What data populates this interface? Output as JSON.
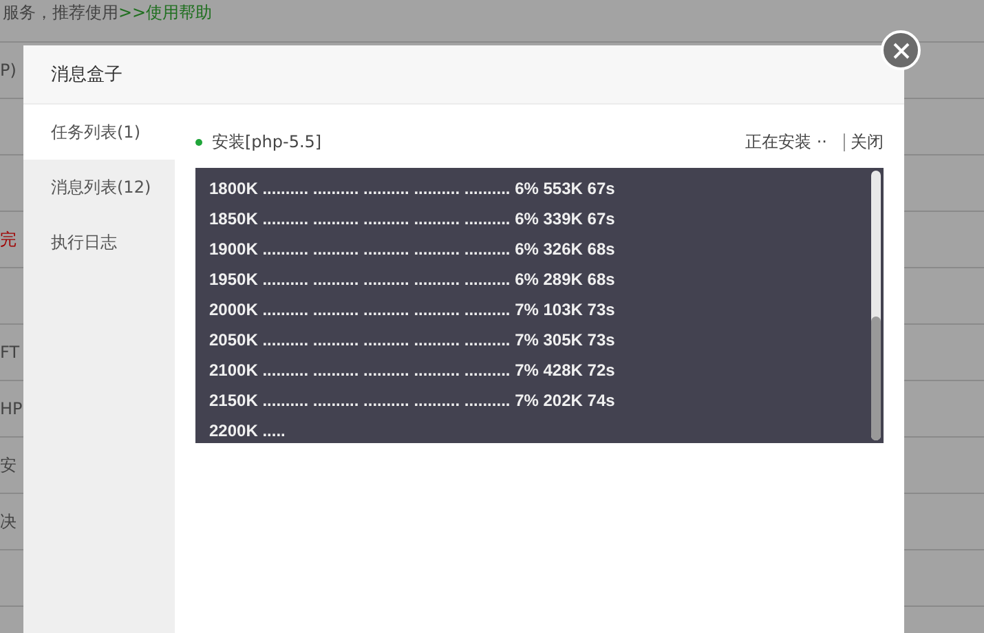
{
  "background": {
    "notice": {
      "text": "服务，推荐使用 ",
      "link": ">>使用帮助"
    },
    "rows": [
      {
        "text": "P)",
        "alert": false
      },
      {
        "text": "完",
        "alert": true
      },
      {
        "text": "FT",
        "alert": false
      },
      {
        "text": "HP",
        "alert": false
      },
      {
        "text": "安",
        "alert": false
      },
      {
        "text": "决",
        "alert": false
      }
    ]
  },
  "dialog": {
    "title": "消息盒子",
    "tabs": [
      {
        "label": "任务列表(1)",
        "selected": true
      },
      {
        "label": "消息列表(12)",
        "selected": false
      },
      {
        "label": "执行日志",
        "selected": false
      }
    ],
    "task": {
      "name": "安装[php-5.5]",
      "status": "正在安装 ··",
      "action": "关闭"
    },
    "log": [
      "1800K .......... .......... .......... .......... .......... 6% 553K 67s",
      "1850K .......... .......... .......... .......... .......... 6% 339K 67s",
      "1900K .......... .......... .......... .......... .......... 6% 326K 68s",
      "1950K .......... .......... .......... .......... .......... 6% 289K 68s",
      "2000K .......... .......... .......... .......... .......... 7% 103K 73s",
      "2050K .......... .......... .......... .......... .......... 7% 305K 73s",
      "2100K .......... .......... .......... .......... .......... 7% 428K 72s",
      "2150K .......... .......... .......... .......... .......... 7% 202K 74s",
      "2200K ....."
    ]
  }
}
